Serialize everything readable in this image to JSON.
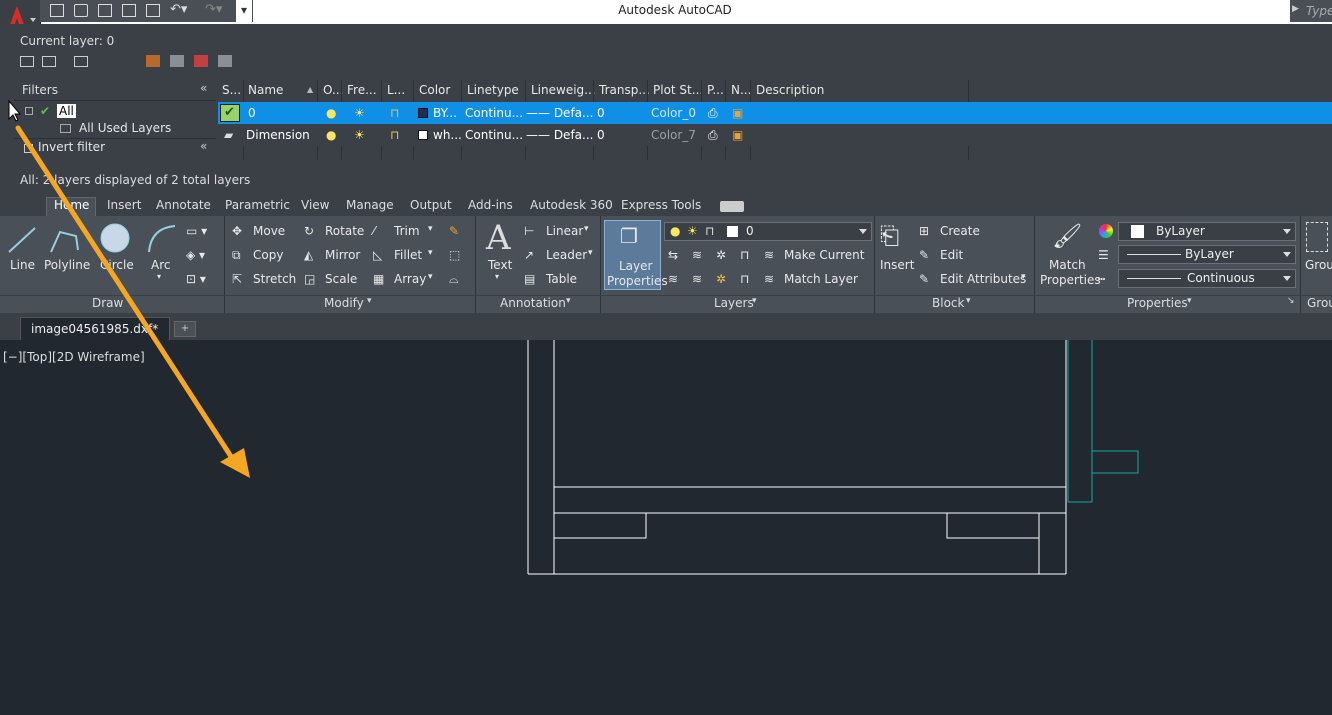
{
  "window": {
    "title": "Autodesk AutoCAD",
    "search_placeholder": "Type"
  },
  "layer_manager": {
    "current_layer": "Current layer: 0",
    "filters_label": "Filters",
    "filter_all": "All",
    "filter_all_used": "All Used Layers",
    "invert_filter": "Invert filter",
    "status": "All: 2 layers displayed of 2 total layers",
    "columns": [
      "S...",
      "Name",
      "O...",
      "Fre...",
      "L...",
      "Color",
      "Linetype",
      "Lineweig...",
      "Transp...",
      "Plot St...",
      "P...",
      "N...",
      "Description"
    ],
    "rows": [
      {
        "name": "0",
        "color": "BY...",
        "linetype": "Continu...",
        "lineweight": "—— Defa...",
        "transparency": "0",
        "plot_style": "Color_0",
        "swatch": "#1c2e5c"
      },
      {
        "name": "Dimension",
        "color": "wh...",
        "linetype": "Continu...",
        "lineweight": "—— Defa...",
        "transparency": "0",
        "plot_style": "Color_7",
        "swatch": "#ffffff"
      }
    ]
  },
  "ribbon": {
    "tabs": [
      "Home",
      "Insert",
      "Annotate",
      "Parametric",
      "View",
      "Manage",
      "Output",
      "Add-ins",
      "Autodesk 360",
      "Express Tools"
    ],
    "draw": {
      "line": "Line",
      "polyline": "Polyline",
      "circle": "Circle",
      "arc": "Arc",
      "title": "Draw"
    },
    "modify": {
      "move": "Move",
      "rotate": "Rotate",
      "trim": "Trim",
      "copy": "Copy",
      "mirror": "Mirror",
      "fillet": "Fillet",
      "stretch": "Stretch",
      "scale": "Scale",
      "array": "Array",
      "title": "Modify"
    },
    "annotation": {
      "text": "Text",
      "linear": "Linear",
      "leader": "Leader",
      "table": "Table",
      "title": "Annotation"
    },
    "layers": {
      "layer_properties_1": "Layer",
      "layer_properties_2": "Properties",
      "layer_dropdown": "0",
      "make_current": "Make Current",
      "match_layer": "Match Layer",
      "title": "Layers"
    },
    "block": {
      "insert": "Insert",
      "create": "Create",
      "edit": "Edit",
      "edit_attributes": "Edit Attributes",
      "title": "Block"
    },
    "properties": {
      "match_1": "Match",
      "match_2": "Properties",
      "color": "ByLayer",
      "lineweight": "ByLayer",
      "linetype": "Continuous",
      "title": "Properties"
    },
    "groups": {
      "label": "Grou",
      "title": "Grou"
    }
  },
  "document": {
    "tab": "image04561985.dxf*",
    "new_tab": "+",
    "viewport_label": "[−][Top][2D Wireframe]"
  },
  "colors": {
    "accent": "#0f8fe6",
    "viewport": "#212830",
    "drawing_white": "#ffffff",
    "drawing_teal": "#1aa6a0",
    "arrow": "#f5a623"
  }
}
